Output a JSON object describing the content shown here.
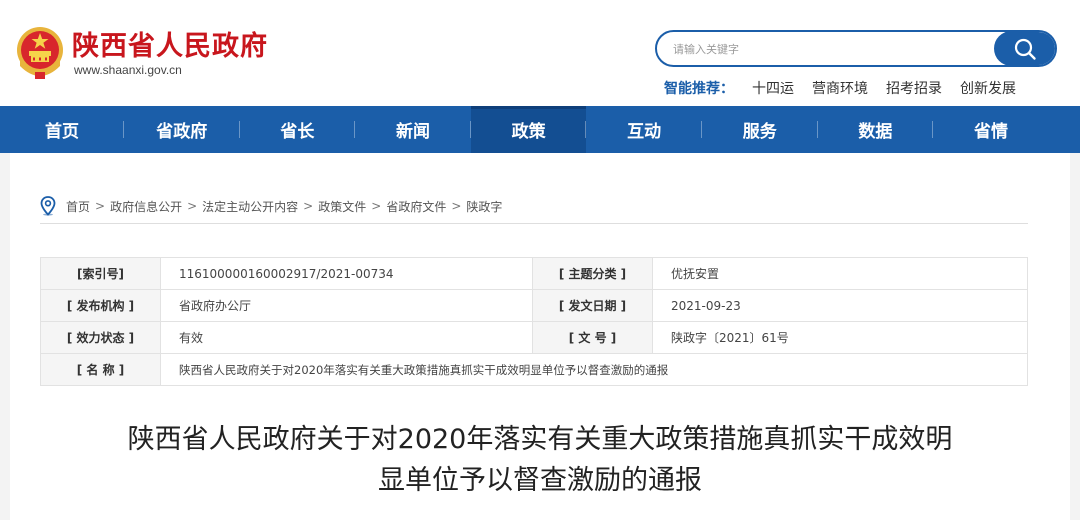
{
  "header": {
    "site_title": "陕西省人民政府",
    "site_domain": "www.shaanxi.gov.cn",
    "search": {
      "placeholder": "请输入关键字",
      "button_icon": "search-icon"
    },
    "hot": {
      "label": "智能推荐：",
      "links": [
        "十四运",
        "营商环境",
        "招考招录",
        "创新发展"
      ]
    }
  },
  "nav": {
    "items": [
      "首页",
      "省政府",
      "省长",
      "新闻",
      "政策",
      "互动",
      "服务",
      "数据",
      "省情"
    ],
    "active_index": 4
  },
  "breadcrumb": {
    "icon": "location-pin-icon",
    "separator": ">",
    "items": [
      "首页",
      "政府信息公开",
      "法定主动公开内容",
      "政策文件",
      "省政府文件",
      "陕政字"
    ]
  },
  "info_table": {
    "index_no": {
      "label": "[索引号]",
      "value": "116100000160002917/2021-00734"
    },
    "topic": {
      "label": "[ 主题分类 ]",
      "value": "优抚安置"
    },
    "issuer": {
      "label": "[ 发布机构 ]",
      "value": "省政府办公厅"
    },
    "issue_date": {
      "label": "[ 发文日期 ]",
      "value": "2021-09-23"
    },
    "status": {
      "label": "[ 效力状态 ]",
      "value": "有效"
    },
    "doc_no": {
      "label": "[ 文 号 ]",
      "value": "陕政字〔2021〕61号"
    },
    "name": {
      "label": "[ 名 称 ]",
      "value": "陕西省人民政府关于对2020年落实有关重大政策措施真抓实干成效明显单位予以督查激励的通报"
    }
  },
  "document": {
    "title_line1": "陕西省人民政府关于对2020年落实有关重大政策措施真抓实干成效明",
    "title_line2": "显单位予以督查激励的通报"
  },
  "colors": {
    "brand_red": "#c8161d",
    "nav_blue": "#1b5ea9",
    "nav_active": "#134e92"
  }
}
